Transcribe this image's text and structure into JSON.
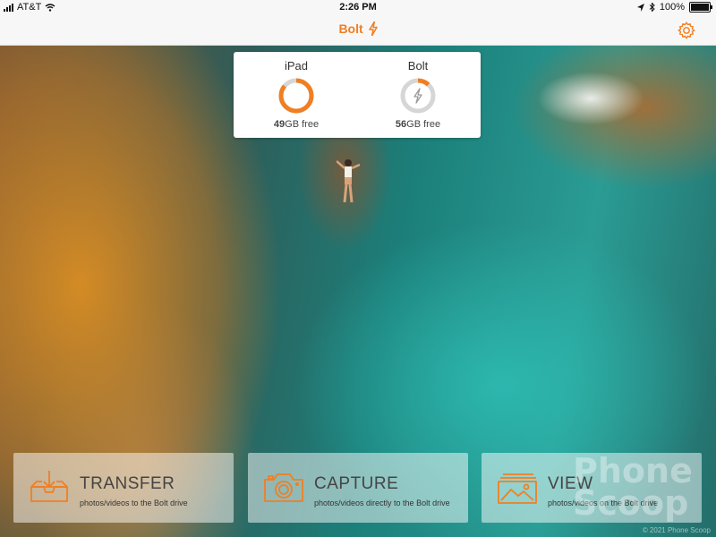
{
  "status_bar": {
    "carrier": "AT&T",
    "time": "2:26 PM",
    "battery": "100%",
    "battery_level": 1.0,
    "icons": [
      "signal-icon",
      "wifi-icon",
      "location-icon",
      "bluetooth-icon",
      "battery-icon"
    ]
  },
  "nav": {
    "title": "Bolt",
    "title_icon": "bolt-icon",
    "settings_icon": "gear-icon",
    "accent_color": "#f07f23"
  },
  "storage": {
    "ipad": {
      "name": "iPad",
      "free_num": "49",
      "free_unit": "GB free",
      "used_fraction": 0.86
    },
    "bolt": {
      "name": "Bolt",
      "free_num": "56",
      "free_unit": "GB free",
      "used_fraction": 0.12
    }
  },
  "actions": [
    {
      "label": "TRANSFER",
      "description": "photos/videos to the Bolt drive",
      "icon": "inbox-download-icon"
    },
    {
      "label": "CAPTURE",
      "description": "photos/videos directly to the Bolt drive",
      "icon": "camera-icon"
    },
    {
      "label": "VIEW",
      "description": "photos/videos on the Bolt drive",
      "icon": "gallery-icon"
    }
  ],
  "watermark": {
    "line1": "Phone",
    "line2": "Scoop",
    "copyright": "© 2021 Phone Scoop"
  }
}
